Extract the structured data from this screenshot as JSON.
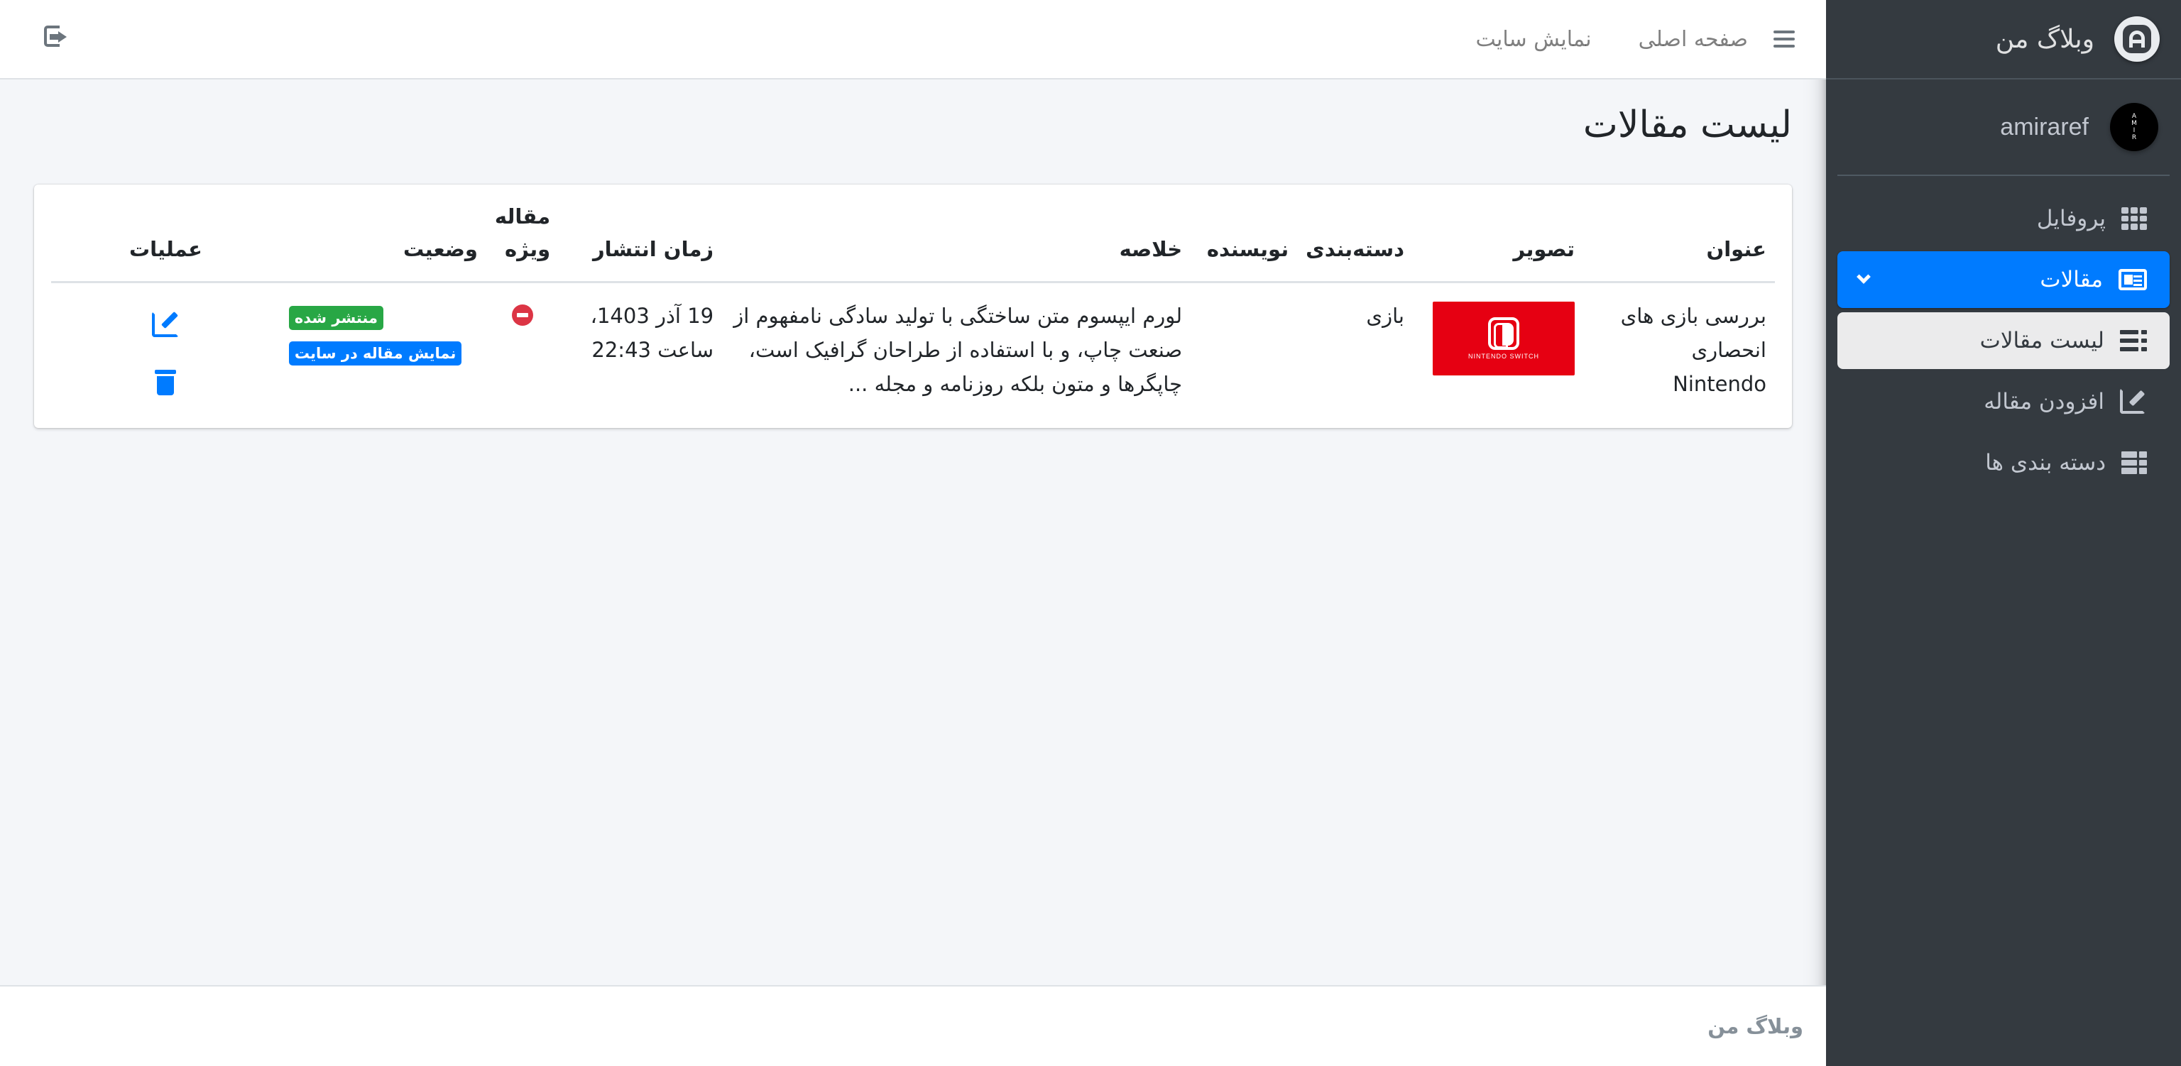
{
  "sidebar": {
    "brand": "وبلاگ من",
    "user": {
      "name": "amiraref",
      "avatar_text": "AMIR"
    },
    "items": [
      {
        "label": "پروفایل",
        "icon": "grid-icon"
      },
      {
        "label": "مقالات",
        "icon": "newspaper-icon",
        "active": true
      },
      {
        "label": "لیست مقالات",
        "icon": "list-icon",
        "sub_active": true
      },
      {
        "label": "افزودن مقاله",
        "icon": "edit-icon"
      },
      {
        "label": "دسته بندی ها",
        "icon": "table-icon"
      }
    ]
  },
  "topbar": {
    "home": "صفحه اصلی",
    "view_site": "نمایش سایت"
  },
  "page": {
    "title": "لیست مقالات"
  },
  "table": {
    "headers": {
      "title": "عنوان",
      "image": "تصویر",
      "category": "دسته‌بندی",
      "author": "نویسنده",
      "summary": "خلاصه",
      "published": "زمان انتشار",
      "featured": "مقاله ویژه",
      "status": "وضعیت",
      "actions": "عملیات"
    },
    "rows": [
      {
        "title": "بررسی بازی های انحصاری Nintendo",
        "image_text": "NINTENDO SWITCH",
        "category": "بازی",
        "author": "",
        "summary": "لورم ایپسوم متن ساختگی با تولید سادگی نامفهوم از صنعت چاپ، و با استفاده از طراحان گرافیک است، چاپگرها و متون بلکه روزنامه و مجله ...",
        "published": "19 آذر 1403، ساعت 22:43",
        "status_badge": "منتشر شده",
        "view_badge": "نمایش مقاله در سایت"
      }
    ]
  },
  "footer": {
    "text": "وبلاگ من"
  },
  "colors": {
    "primary": "#007bff",
    "sidebar": "#343a40",
    "success": "#28a745",
    "danger": "#dc3545",
    "nintendo": "#e60012"
  }
}
